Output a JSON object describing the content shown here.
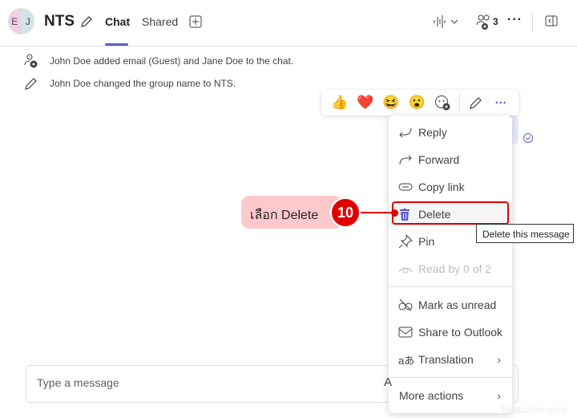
{
  "header": {
    "avatar_initials": [
      "E",
      "J"
    ],
    "title": "NTS",
    "tabs": [
      {
        "label": "Chat",
        "active": true
      },
      {
        "label": "Shared"
      }
    ],
    "participants_count": "3"
  },
  "system_messages": [
    {
      "icon": "person-add-icon",
      "text": "John Doe added email (Guest) and Jane Doe to the chat."
    },
    {
      "icon": "pencil-icon",
      "text": "John Doe changed the group name to NTS."
    }
  ],
  "reactions": [
    "👍",
    "❤️",
    "😆",
    "😮"
  ],
  "menu": {
    "items": [
      {
        "label": "Reply",
        "icon": "reply-icon"
      },
      {
        "label": "Forward",
        "icon": "forward-icon"
      },
      {
        "label": "Copy link",
        "icon": "link-icon"
      },
      {
        "label": "Delete",
        "icon": "trash-icon",
        "highlighted": true
      },
      {
        "label": "Pin",
        "icon": "pin-icon"
      },
      {
        "label": "Read by 0 of 2",
        "icon": "eye-icon",
        "disabled": true
      }
    ],
    "items2": [
      {
        "label": "Mark as unread",
        "icon": "unread-icon"
      },
      {
        "label": "Share to Outlook",
        "icon": "mail-icon"
      },
      {
        "label": "Translation",
        "icon": "translate-icon",
        "submenu": true
      }
    ],
    "more": {
      "label": "More actions",
      "submenu": true
    }
  },
  "tooltip": "Delete this message",
  "callout": {
    "text": "เลือก Delete",
    "step": "10"
  },
  "composer": {
    "placeholder": "Type a message"
  },
  "watermark": "hostatom.com",
  "colors": {
    "accent": "#5b5fc7",
    "callout_red": "#e00000",
    "callout_bg": "#ffc9cc"
  }
}
